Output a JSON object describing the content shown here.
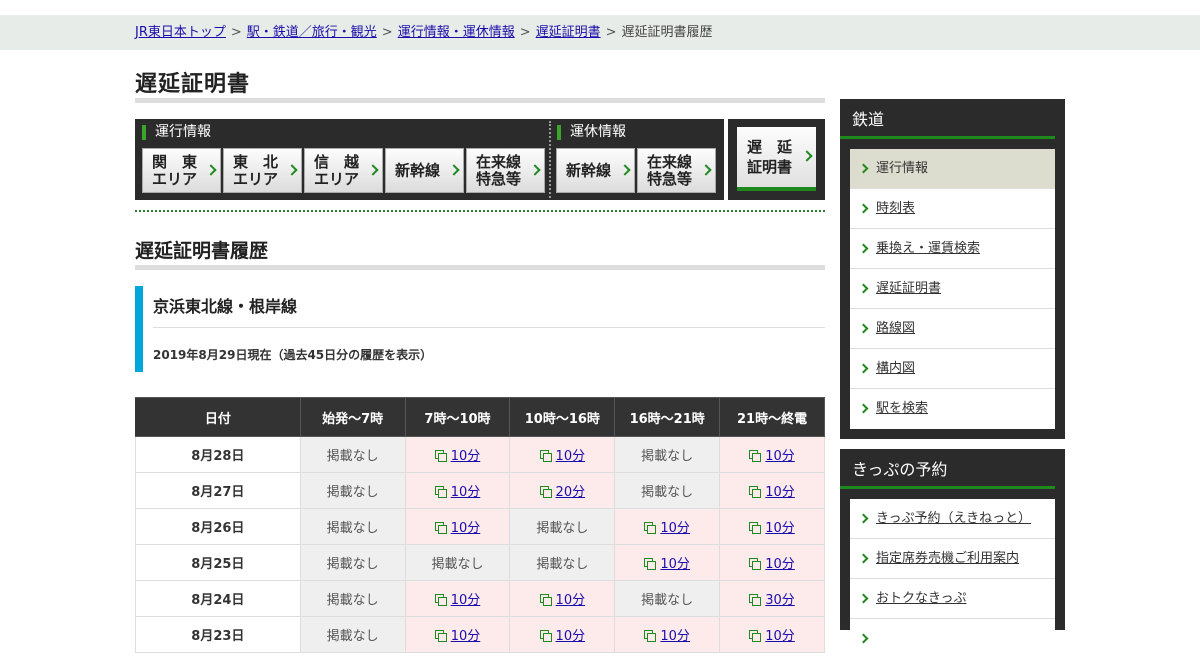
{
  "breadcrumb": {
    "items": [
      "JR東日本トップ",
      "駅・鉄道／旅行・観光",
      "運行情報・運休情報",
      "遅延証明書"
    ],
    "separator": ">",
    "current": "遅延証明書履歴"
  },
  "page_title": "遅延証明書",
  "nav": {
    "group1_label": "運行情報",
    "group2_label": "運休情報",
    "buttons": [
      "関　東\nエリア",
      "東　北\nエリア",
      "信　越\nエリア",
      "新幹線",
      "在来線\n特急等",
      "新幹線",
      "在来線\n特急等"
    ],
    "cert_button": "遅　延\n証明書"
  },
  "section_title": "遅延証明書履歴",
  "line": {
    "name": "京浜東北線・根岸線",
    "note": "2019年8月29日現在（過去45日分の履歴を表示）"
  },
  "table": {
    "headers": [
      "日付",
      "始発～7時",
      "7時～10時",
      "10時～16時",
      "16時～21時",
      "21時～終電"
    ],
    "rows": [
      {
        "date": "8月28日",
        "cells": [
          "掲載なし",
          "10分",
          "10分",
          "掲載なし",
          "10分"
        ]
      },
      {
        "date": "8月27日",
        "cells": [
          "掲載なし",
          "10分",
          "20分",
          "掲載なし",
          "10分"
        ]
      },
      {
        "date": "8月26日",
        "cells": [
          "掲載なし",
          "10分",
          "掲載なし",
          "10分",
          "10分"
        ]
      },
      {
        "date": "8月25日",
        "cells": [
          "掲載なし",
          "掲載なし",
          "掲載なし",
          "10分",
          "10分"
        ]
      },
      {
        "date": "8月24日",
        "cells": [
          "掲載なし",
          "10分",
          "10分",
          "掲載なし",
          "30分"
        ]
      },
      {
        "date": "8月23日",
        "cells": [
          "掲載なし",
          "10分",
          "10分",
          "10分",
          "10分"
        ]
      }
    ],
    "none_label": "掲載なし"
  },
  "sidebar": {
    "railway": {
      "title": "鉄道",
      "items": [
        "運行情報",
        "時刻表",
        "乗換え・運賃検索",
        "遅延証明書",
        "路線図",
        "構内図",
        "駅を検索"
      ]
    },
    "tickets": {
      "title": "きっぷの予約",
      "items": [
        "きっぷ予約（えきねっと）",
        "指定席券売機ご利用案内",
        "おトクなきっぷ",
        ""
      ]
    }
  },
  "colors": {
    "accent_green": "#1e8a1e",
    "line_color": "#00a7db",
    "dark_panel": "#2b2b2b",
    "delay_bg": "#fdeaea"
  }
}
